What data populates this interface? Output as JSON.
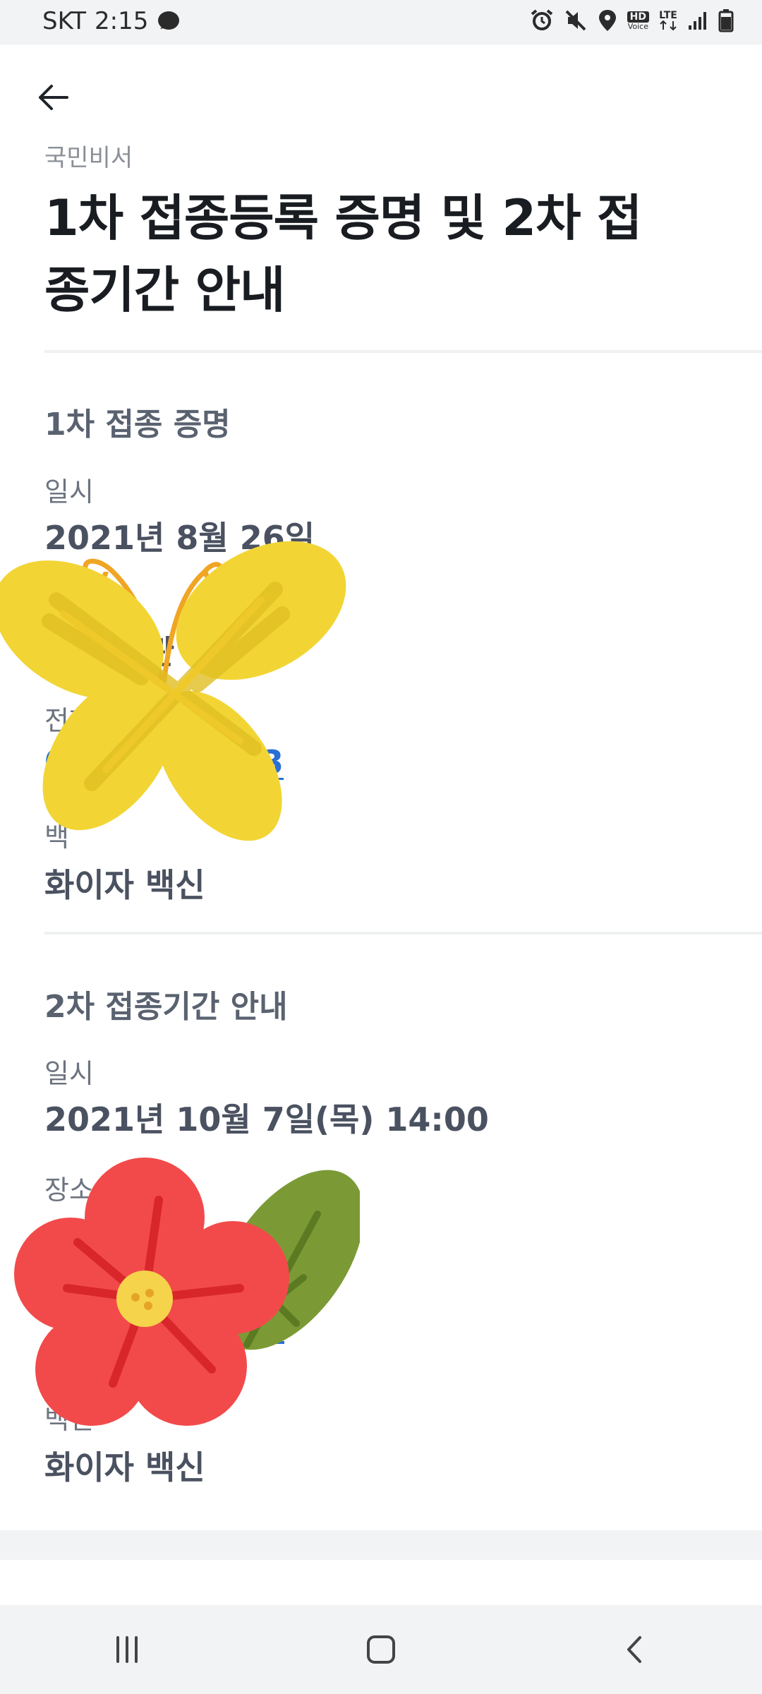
{
  "status_bar": {
    "carrier": "SKT",
    "time": "2:15",
    "hd_label": "HD",
    "voice_label": "Voice",
    "lte_label": "LTE"
  },
  "message": {
    "sender": "국민비서",
    "title": "1차 접종등록 증명 및 2차 접종기간 안내"
  },
  "first_dose": {
    "section_title": "1차 접종 증명",
    "date_label": "일시",
    "date_value": "2021년 8월 26일",
    "place_value": "관",
    "phone_label": "전화",
    "phone_value_start": "06",
    "phone_value_end": "3",
    "vaccine_label": "백",
    "vaccine_value": "화이자 백신"
  },
  "second_dose": {
    "section_title": "2차 접종기간 안내",
    "date_label": "일시",
    "date_value": "2021년 10월 7일(목) 14:00",
    "place_label": "장소",
    "vaccine_label": "백신",
    "vaccine_value": "화이자 백신"
  },
  "icons": {
    "back": "arrow-left-icon",
    "nav_recent": "recent-apps-icon",
    "nav_home": "home-icon",
    "nav_back": "chevron-left-icon",
    "sticker_1": "butterfly-sticker",
    "sticker_2": "flower-sticker"
  },
  "colors": {
    "phone_link": "#2a6fd6",
    "butterfly": "#f2d535",
    "flower": "#f24a4a",
    "leaf": "#7b9a36"
  }
}
